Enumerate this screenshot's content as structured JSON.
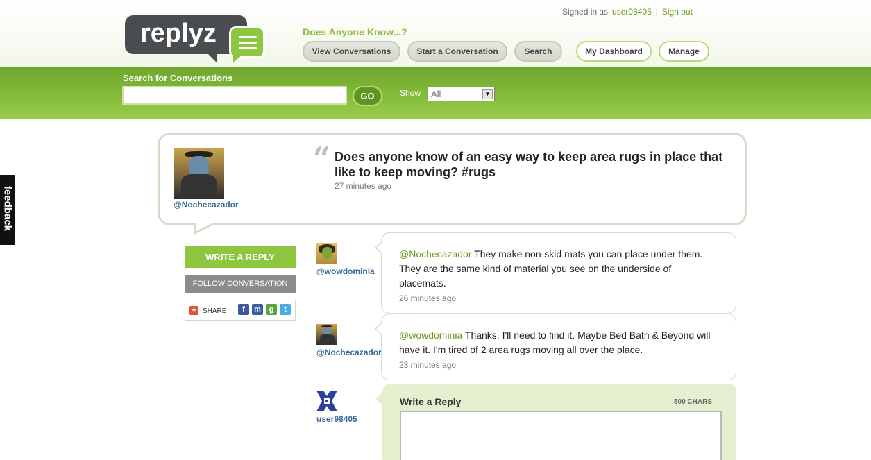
{
  "app": {
    "logo_text": "replyz"
  },
  "header": {
    "signed_in_label": "Signed in as",
    "username": "user98405",
    "separator": "|",
    "sign_out": "Sign out",
    "tagline": "Does Anyone Know...?",
    "nav": {
      "view_conversations": "View Conversations",
      "start_conversation": "Start a Conversation",
      "search": "Search",
      "my_dashboard": "My Dashboard",
      "manage": "Manage"
    }
  },
  "search_band": {
    "title": "Search for Conversations",
    "input_value": "",
    "go_label": "GO",
    "show_label": "Show",
    "show_selected": "All"
  },
  "feedback_tab": "feedback",
  "question": {
    "author": "@Nochecazador",
    "text": "Does anyone know of an easy way to keep area rugs in place that like to keep moving? #rugs",
    "time": "27 minutes ago"
  },
  "sidebar": {
    "write_reply": "WRITE A REPLY",
    "follow": "FOLLOW CONVERSATION",
    "share": "SHARE",
    "share_plus": "+",
    "share_icons": [
      "facebook-icon",
      "myspace-icon",
      "google-icon",
      "twitter-icon"
    ]
  },
  "replies": [
    {
      "author": "@wowdominia",
      "mention": "@Nochecazador",
      "text": " They make non-skid mats you can place under them. They are the same kind of material you see on the underside of placemats.",
      "time": "26 minutes ago"
    },
    {
      "author": "@Nochecazador",
      "mention": "@wowdominia",
      "text": " Thanks. I'll need to find it. Maybe Bed Bath & Beyond will have it. I'm tired of 2 area rugs moving all over the place.",
      "time": "23 minutes ago"
    }
  ],
  "write_panel": {
    "author": "user98405",
    "title": "Write a Reply",
    "chars": "500 CHARS",
    "value": ""
  },
  "colors": {
    "brand_green": "#8dc63f",
    "band_green": "#7bb234",
    "link_blue": "#3b6b9a",
    "logo_gray": "#4a4d4f"
  }
}
